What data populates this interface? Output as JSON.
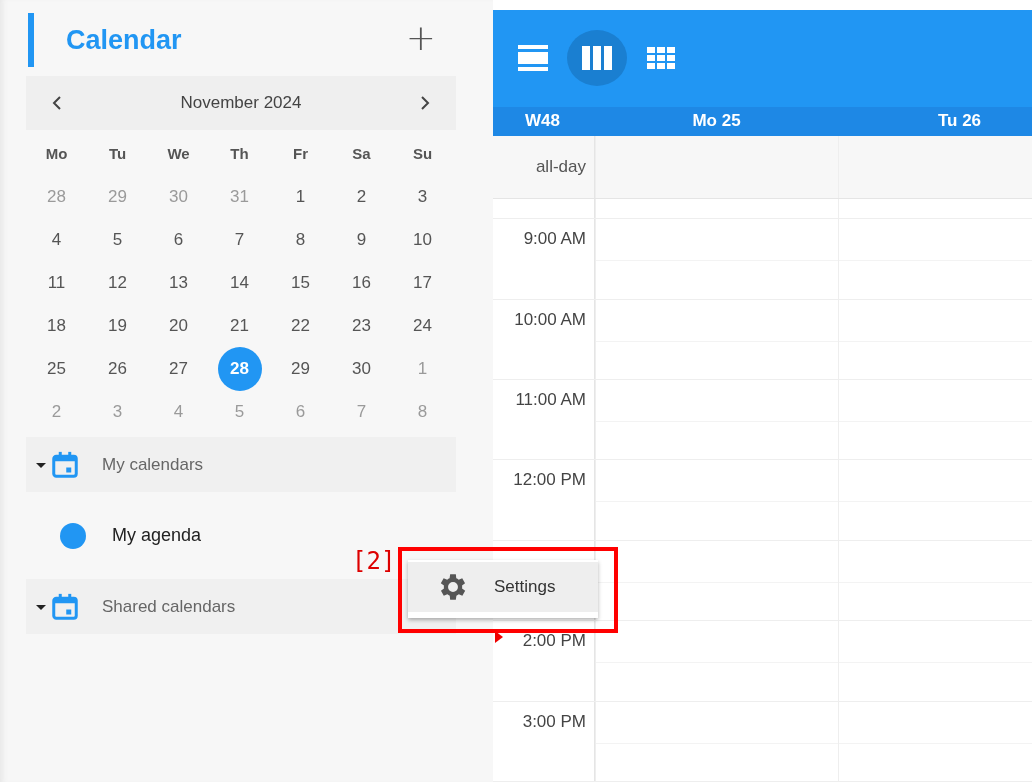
{
  "sidebar": {
    "title": "Calendar",
    "add_button": "+",
    "month_nav": {
      "label": "November 2024"
    },
    "weekdays": [
      "Mo",
      "Tu",
      "We",
      "Th",
      "Fr",
      "Sa",
      "Su"
    ],
    "days": [
      {
        "label": "28",
        "outside": true,
        "selected": false
      },
      {
        "label": "29",
        "outside": true,
        "selected": false
      },
      {
        "label": "30",
        "outside": true,
        "selected": false
      },
      {
        "label": "31",
        "outside": true,
        "selected": false
      },
      {
        "label": "1",
        "outside": false,
        "selected": false
      },
      {
        "label": "2",
        "outside": false,
        "selected": false
      },
      {
        "label": "3",
        "outside": false,
        "selected": false
      },
      {
        "label": "4",
        "outside": false,
        "selected": false
      },
      {
        "label": "5",
        "outside": false,
        "selected": false
      },
      {
        "label": "6",
        "outside": false,
        "selected": false
      },
      {
        "label": "7",
        "outside": false,
        "selected": false
      },
      {
        "label": "8",
        "outside": false,
        "selected": false
      },
      {
        "label": "9",
        "outside": false,
        "selected": false
      },
      {
        "label": "10",
        "outside": false,
        "selected": false
      },
      {
        "label": "11",
        "outside": false,
        "selected": false
      },
      {
        "label": "12",
        "outside": false,
        "selected": false
      },
      {
        "label": "13",
        "outside": false,
        "selected": false
      },
      {
        "label": "14",
        "outside": false,
        "selected": false
      },
      {
        "label": "15",
        "outside": false,
        "selected": false
      },
      {
        "label": "16",
        "outside": false,
        "selected": false
      },
      {
        "label": "17",
        "outside": false,
        "selected": false
      },
      {
        "label": "18",
        "outside": false,
        "selected": false
      },
      {
        "label": "19",
        "outside": false,
        "selected": false
      },
      {
        "label": "20",
        "outside": false,
        "selected": false
      },
      {
        "label": "21",
        "outside": false,
        "selected": false
      },
      {
        "label": "22",
        "outside": false,
        "selected": false
      },
      {
        "label": "23",
        "outside": false,
        "selected": false
      },
      {
        "label": "24",
        "outside": false,
        "selected": false
      },
      {
        "label": "25",
        "outside": false,
        "selected": false
      },
      {
        "label": "26",
        "outside": false,
        "selected": false
      },
      {
        "label": "27",
        "outside": false,
        "selected": false
      },
      {
        "label": "28",
        "outside": false,
        "selected": true
      },
      {
        "label": "29",
        "outside": false,
        "selected": false
      },
      {
        "label": "30",
        "outside": false,
        "selected": false
      },
      {
        "label": "1",
        "outside": true,
        "selected": false
      },
      {
        "label": "2",
        "outside": true,
        "selected": false
      },
      {
        "label": "3",
        "outside": true,
        "selected": false
      },
      {
        "label": "4",
        "outside": true,
        "selected": false
      },
      {
        "label": "5",
        "outside": true,
        "selected": false
      },
      {
        "label": "6",
        "outside": true,
        "selected": false
      },
      {
        "label": "7",
        "outside": true,
        "selected": false
      },
      {
        "label": "8",
        "outside": true,
        "selected": false
      }
    ],
    "groups": [
      {
        "label": "My calendars",
        "expanded": true,
        "children": [
          {
            "label": "My agenda",
            "color": "#2196f3"
          }
        ]
      },
      {
        "label": "Shared calendars",
        "expanded": true
      }
    ]
  },
  "toolbar": {
    "views": [
      {
        "kind": "list",
        "selected": false
      },
      {
        "kind": "week",
        "selected": true
      },
      {
        "kind": "month",
        "selected": false
      }
    ]
  },
  "week_header": {
    "week": "W48",
    "days": [
      "Mo 25",
      "Tu 26"
    ]
  },
  "all_day_label": "all-day",
  "slots": [
    {
      "label": "9:00 AM",
      "now": false
    },
    {
      "label": "10:00 AM",
      "now": false
    },
    {
      "label": "11:00 AM",
      "now": false
    },
    {
      "label": "12:00 PM",
      "now": false
    },
    {
      "now": false
    },
    {
      "label": "2:00 PM",
      "now": true
    },
    {
      "label": "3:00 PM",
      "now": false
    }
  ],
  "context_menu": {
    "items": [
      {
        "label": "Settings",
        "kind": "settings"
      }
    ]
  },
  "annotation": {
    "label": "[2]"
  }
}
